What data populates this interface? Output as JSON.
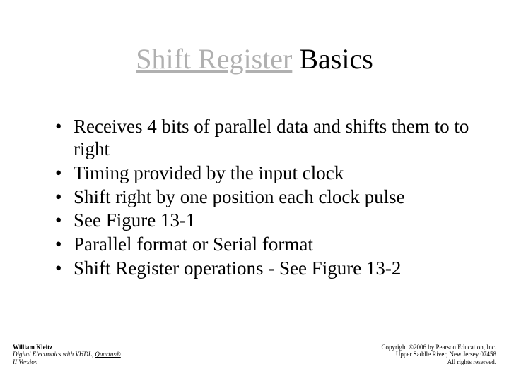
{
  "title": {
    "underlined": "Shift Register",
    "rest": " Basics"
  },
  "bullets": [
    "Receives 4 bits of parallel data and shifts them to to right",
    "Timing provided by the input clock",
    "Shift right by one position each clock pulse",
    "See Figure 13-1",
    "Parallel format or Serial format",
    "Shift Register operations - See Figure 13-2"
  ],
  "footer_left": {
    "author": "William Kleitz",
    "book_part1": "Digital Electronics with VHDL, ",
    "book_underlined": "Quartus®",
    "version": "II Version"
  },
  "footer_right": {
    "line1": "Copyright ©2006 by Pearson Education, Inc.",
    "line2": "Upper Saddle River, New Jersey 07458",
    "line3": "All rights reserved."
  }
}
